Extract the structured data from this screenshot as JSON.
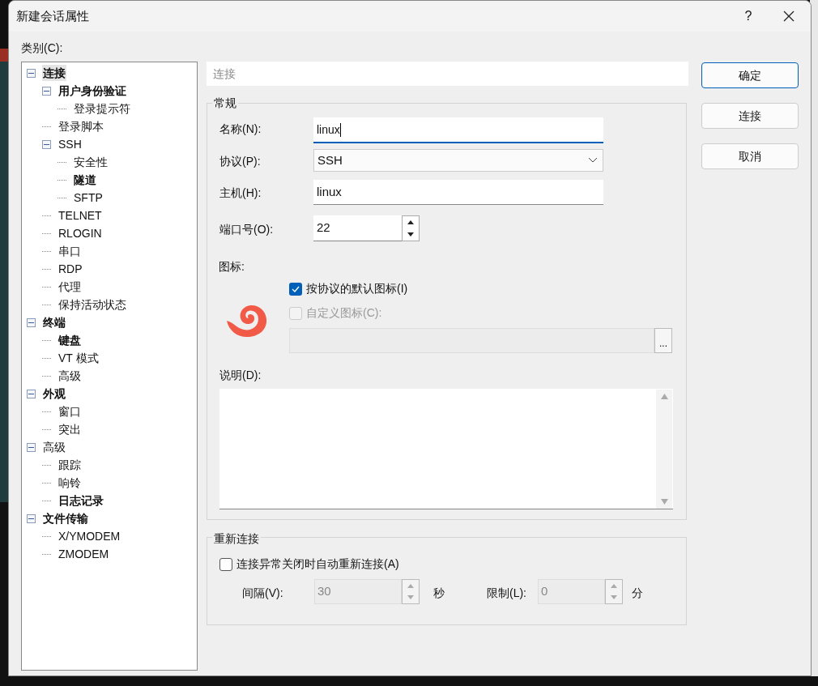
{
  "window": {
    "title": "新建会话属性",
    "help": "?"
  },
  "category_label": "类别(C):",
  "tree": [
    {
      "label": "连接",
      "bold": true,
      "selected": true,
      "expanded": true,
      "children": [
        {
          "label": "用户身份验证",
          "bold": true,
          "selected": false,
          "expanded": true,
          "children": [
            {
              "label": "登录提示符",
              "bold": false,
              "selected": false
            }
          ]
        },
        {
          "label": "登录脚本",
          "bold": false,
          "selected": false
        },
        {
          "label": "SSH",
          "bold": false,
          "selected": false,
          "expanded": true,
          "children": [
            {
              "label": "安全性",
              "bold": false,
              "selected": false
            },
            {
              "label": "隧道",
              "bold": true,
              "selected": false
            },
            {
              "label": "SFTP",
              "bold": false,
              "selected": false
            }
          ]
        },
        {
          "label": "TELNET",
          "bold": false,
          "selected": false
        },
        {
          "label": "RLOGIN",
          "bold": false,
          "selected": false
        },
        {
          "label": "串口",
          "bold": false,
          "selected": false
        },
        {
          "label": "RDP",
          "bold": false,
          "selected": false
        },
        {
          "label": "代理",
          "bold": false,
          "selected": false
        },
        {
          "label": "保持活动状态",
          "bold": false,
          "selected": false
        }
      ]
    },
    {
      "label": "终端",
      "bold": true,
      "selected": false,
      "expanded": true,
      "children": [
        {
          "label": "键盘",
          "bold": true,
          "selected": false
        },
        {
          "label": "VT 模式",
          "bold": false,
          "selected": false
        },
        {
          "label": "高级",
          "bold": false,
          "selected": false
        }
      ]
    },
    {
      "label": "外观",
      "bold": true,
      "selected": false,
      "expanded": true,
      "children": [
        {
          "label": "窗口",
          "bold": false,
          "selected": false
        },
        {
          "label": "突出",
          "bold": false,
          "selected": false
        }
      ]
    },
    {
      "label": "高级",
      "bold": false,
      "selected": false,
      "expanded": true,
      "children": [
        {
          "label": "跟踪",
          "bold": false,
          "selected": false
        },
        {
          "label": "响铃",
          "bold": false,
          "selected": false
        },
        {
          "label": "日志记录",
          "bold": true,
          "selected": false
        }
      ]
    },
    {
      "label": "文件传输",
      "bold": true,
      "selected": false,
      "expanded": true,
      "children": [
        {
          "label": "X/YMODEM",
          "bold": false,
          "selected": false
        },
        {
          "label": "ZMODEM",
          "bold": false,
          "selected": false
        }
      ]
    }
  ],
  "panel_title": "连接",
  "general": {
    "title": "常规",
    "name": {
      "label": "名称(N):",
      "value": "linux"
    },
    "protocol": {
      "label": "协议(P):",
      "value": "SSH"
    },
    "host": {
      "label": "主机(H):",
      "value": "linux"
    },
    "port": {
      "label": "端口号(O):",
      "value": "22"
    },
    "icon_label": "图标:",
    "default_icon": {
      "label": "按协议的默认图标(I)",
      "checked": true
    },
    "custom_icon": {
      "label": "自定义图标(C):",
      "checked": false,
      "disabled": true
    },
    "browse_button": "...",
    "description_label": "说明(D):"
  },
  "reconnect": {
    "title": "重新连接",
    "auto": {
      "label": "连接异常关闭时自动重新连接(A)",
      "checked": false
    },
    "interval": {
      "label": "间隔(V):",
      "value": "30",
      "unit": "秒",
      "disabled": true
    },
    "limit": {
      "label": "限制(L):",
      "value": "0",
      "unit": "分",
      "disabled": true
    }
  },
  "buttons": [
    {
      "label": "确定",
      "default": true
    },
    {
      "label": "连接",
      "default": false
    },
    {
      "label": "取消",
      "default": false
    }
  ]
}
